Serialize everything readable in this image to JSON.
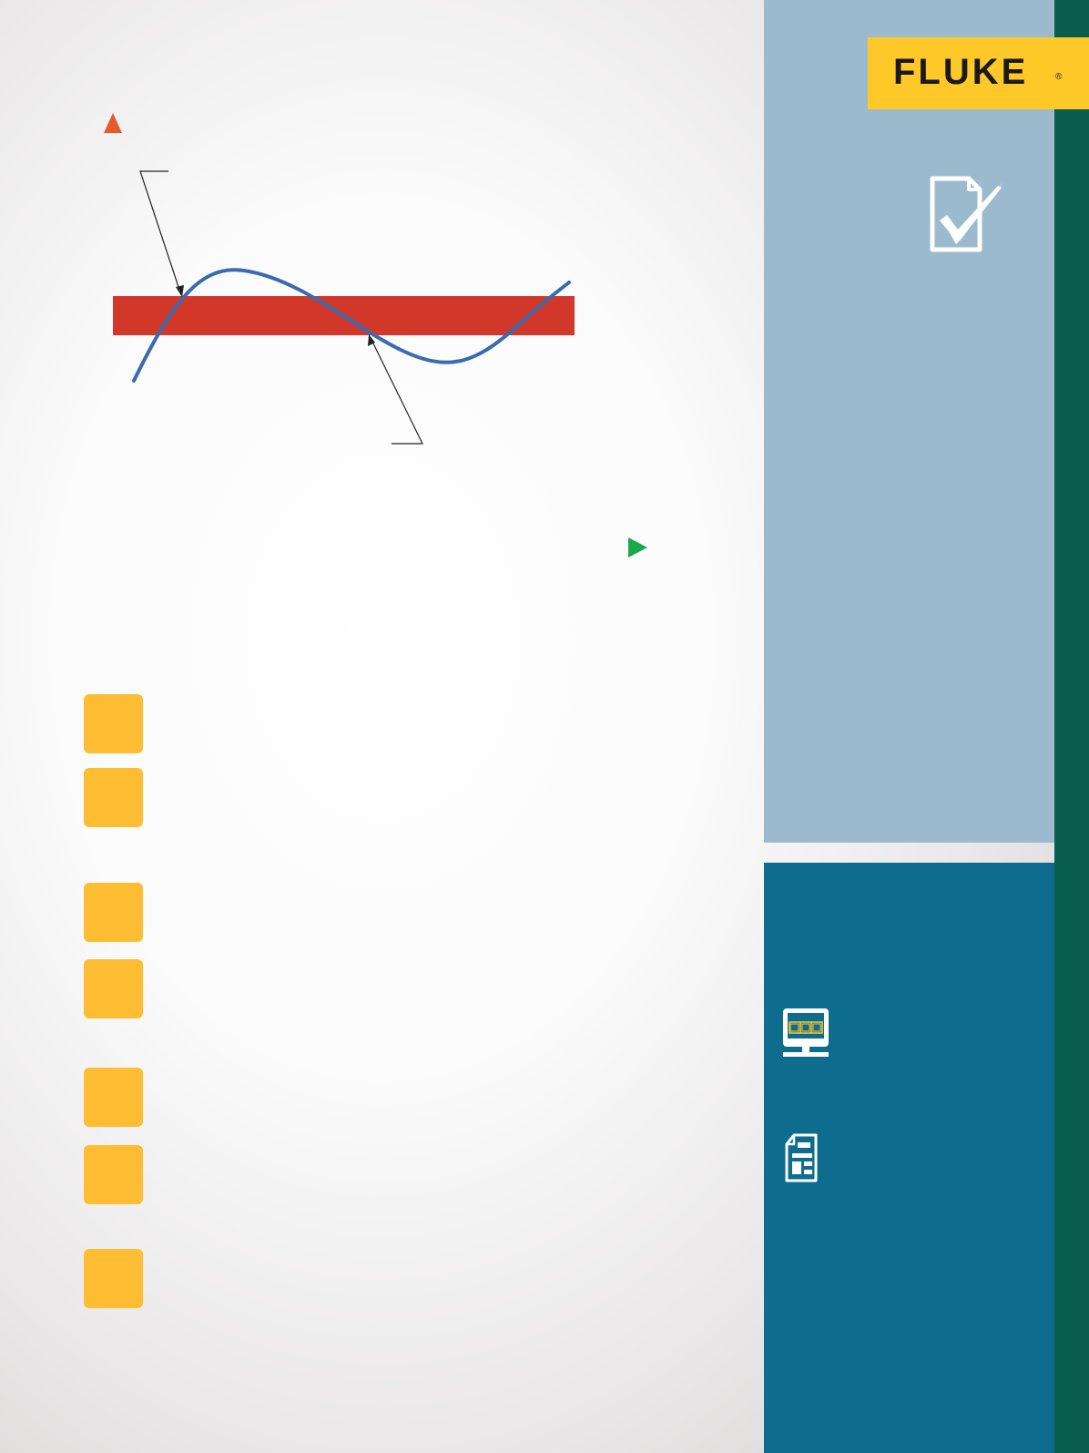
{
  "logo": {
    "text": "FLUKE",
    "registered_mark": "®"
  },
  "diagram": {
    "axis_colors": {
      "y_axis": "#e85a2c",
      "x_axis": "#1aa84f",
      "origin_blend": "#d6d21f"
    },
    "band_color": "#d1382a",
    "curve_color": "#3a6ab0",
    "callout_color": "#222222"
  },
  "steps": {
    "count": 7,
    "box_color": "#ffbd33"
  },
  "sidebar": {
    "top_color": "#9bbace",
    "bottom_color": "#0e6d8e",
    "strip_color": "#095e4f",
    "icons": [
      "checklist-icon",
      "monitor-icon",
      "document-icon"
    ]
  }
}
